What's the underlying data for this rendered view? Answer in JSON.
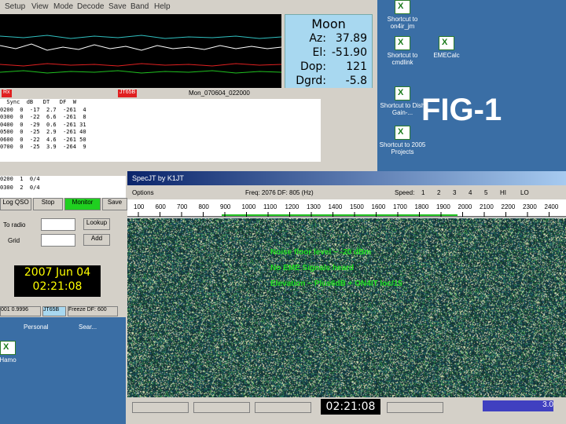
{
  "wsjt": {
    "menu": [
      "Setup",
      "View",
      "Mode",
      "Decode",
      "Save",
      "Band",
      "Help"
    ],
    "moon": {
      "title": "Moon",
      "rows": [
        {
          "k": "Az:",
          "v": "37.89"
        },
        {
          "k": "El:",
          "v": "-51.90"
        },
        {
          "k": "Dop:",
          "v": "121"
        },
        {
          "k": "Dgrd:",
          "v": "-5.8"
        }
      ]
    },
    "redbar": {
      "left": "Rx",
      "right": "JT65B"
    },
    "file_id": "Mon_070604_022000",
    "decode_header": "  Sync  dB   DT   DF  W",
    "decode_rows": [
      "0200  0  -17  2.7  -261  4",
      "0300  0  -22  6.6  -261  8",
      "0400  0  -29  0.6  -261 31",
      "0500  0  -25  2.9  -261 40",
      "0600  0  -22  4.6  -261 50",
      "0700  0  -25  3.9  -264  9"
    ],
    "avg_rows": [
      "0200  1  0/4",
      "0300  2  0/4"
    ],
    "buttons": {
      "log": "Log QSO",
      "stop": "Stop",
      "monitor": "Monitor",
      "save": "Save",
      "lookup": "Lookup",
      "add": "Add"
    },
    "labels": {
      "tocall": "To radio",
      "grid": "Grid"
    },
    "clock": {
      "date": "2007 Jun 04",
      "time": "02:21:08"
    },
    "status": [
      "001 0.9996",
      "JT65B",
      "Freeze DF: 600"
    ],
    "bottom_labels": [
      "Personal",
      "Sear..."
    ]
  },
  "desktop": {
    "icons": [
      {
        "label": "Shortcut to on4ir_jm"
      },
      {
        "label": "Shortcut to cmdlink"
      },
      {
        "label": "Shortcut to Dish Gain-..."
      },
      {
        "label": "Shortcut to 2005 Projects"
      },
      {
        "label": "EMECalc"
      }
    ],
    "fig_label": "FIG-1",
    "bottom_icon": "Hamo"
  },
  "spec": {
    "title": "SpecJT   by K1JT",
    "options": "Options",
    "freq": "Freq: 2076   DF: 805  (Hz)",
    "speed": "Speed:",
    "speed_opts": [
      "1",
      "2",
      "3",
      "4",
      "5",
      "HI",
      "LO"
    ],
    "scale_ticks": [
      "100",
      "600",
      "700",
      "800",
      "900",
      "1000",
      "1100",
      "1200",
      "1300",
      "1400",
      "1500",
      "1600",
      "1700",
      "1800",
      "1900",
      "2000",
      "2100",
      "2200",
      "2300",
      "2400"
    ],
    "notes": [
      "Noise floor level ~ -20 dBm",
      "No EME Signals heard",
      "Elevation ~ Plus6dB + ON4IT loc/15"
    ],
    "clock": "02:21:08",
    "status_right": "3.0"
  }
}
